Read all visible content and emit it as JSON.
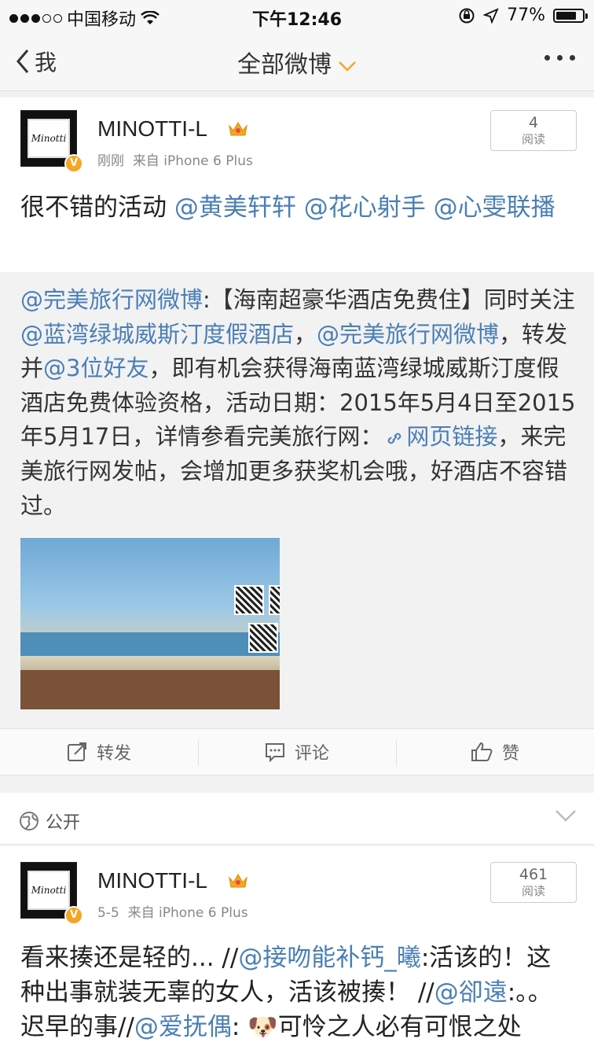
{
  "status_bar": {
    "carrier": "中国移动",
    "time": "下午12:46",
    "battery": "77%",
    "battery_level": 0.77
  },
  "nav": {
    "back_label": "我",
    "title": "全部微博"
  },
  "post1": {
    "username": "MINOTTI-L",
    "time": "刚刚",
    "source": "来自 iPhone 6 Plus",
    "read_count": "4",
    "read_label": "阅读",
    "text_plain": "很不错的活动 ",
    "mentions": [
      "@黄美轩轩",
      "@花心射手",
      "@心雯联播"
    ],
    "repost": {
      "author": "@完美旅行网微博",
      "p1": ":【海南超豪华酒店免费住】同时关注",
      "m1": "@蓝湾绿城威斯汀度假酒店",
      "p2": "，",
      "m2": "@完美旅行网微博",
      "p3": "，转发并",
      "m3": "@3位好友",
      "p4": "，即有机会获得海南蓝湾绿城威斯汀度假酒店免费体验资格，活动日期：2015年5月4日至2015年5月17日，详情参看完美旅行网：",
      "link": "网页链接",
      "p5": "，来完美旅行网发帖，会增加更多获奖机会哦，好酒店不容错过。"
    },
    "actions": {
      "repost": "转发",
      "comment": "评论",
      "like": "赞"
    }
  },
  "visibility": {
    "label": "公开"
  },
  "post2": {
    "username": "MINOTTI-L",
    "time": "5-5",
    "source": "来自 iPhone 6 Plus",
    "read_count": "461",
    "read_label": "阅读",
    "t1": "看来揍还是轻的... //",
    "m1": "@接吻能补钙_曦",
    "t2": ":活该的！这种出事就装无辜的女人，活该被揍！ //",
    "m2": "@卻遠",
    "t3": ":。。迟早的事//",
    "m3": "@爱抚偶",
    "t4": ": 🐶可怜之人必有可恨之处"
  },
  "colors": {
    "link": "#4a7fb5",
    "accent": "#f5a623",
    "background": "#f2f2f2"
  },
  "icons": [
    "back-chevron-icon",
    "caret-down-icon",
    "more-dots-icon",
    "crown-icon",
    "verified-icon",
    "link-icon",
    "repost-icon",
    "comment-icon",
    "like-icon",
    "globe-icon",
    "chevron-down-icon"
  ]
}
